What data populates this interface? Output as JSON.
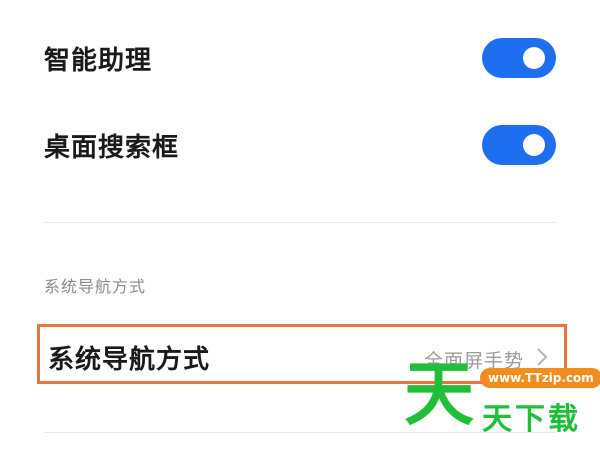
{
  "settings": {
    "items": [
      {
        "label": "智能助理",
        "enabled": true
      },
      {
        "label": "桌面搜索框",
        "enabled": true
      }
    ]
  },
  "nav_section": {
    "header": "系统导航方式",
    "row_label": "系统导航方式",
    "row_value": "全面屏手势",
    "chevron_icon": "chevron-right-icon"
  },
  "colors": {
    "toggle_on": "#1e6ff0",
    "highlight_border": "#e8743e",
    "watermark_green": "#1fbf3a",
    "watermark_orange": "#f28c1c"
  },
  "watermark": {
    "big_char": "天",
    "url": "www.TTzip.com",
    "text": "天下载"
  }
}
